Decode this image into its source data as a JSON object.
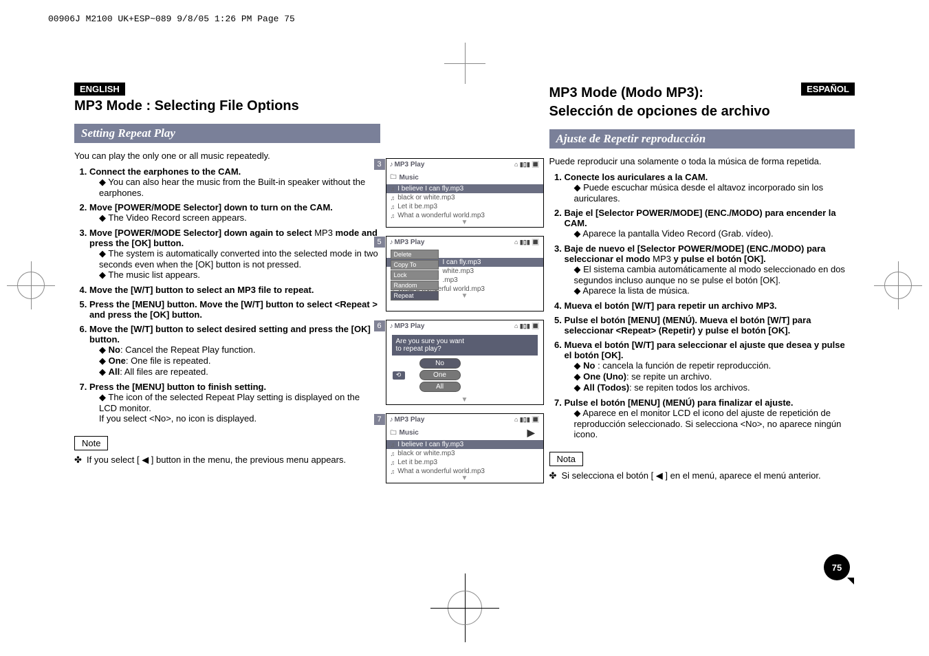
{
  "meta": {
    "running_head": "00906J M2100 UK+ESP~089  9/8/05 1:26 PM  Page 75"
  },
  "left": {
    "lang": "ENGLISH",
    "title": "MP3 Mode : Selecting File Options",
    "subhead": "Setting Repeat Play",
    "intro": "You can play the only one or all music repeatedly.",
    "step1": "Connect the earphones to the CAM.",
    "step1a": "You can also hear the music from the Built-in speaker without the earphones.",
    "step2": "Move [POWER/MODE Selector] down to turn on the CAM.",
    "step2a": "The Video Record screen appears.",
    "step3a": "Move [POWER/MODE Selector] down again to select ",
    "step3mode": "MP3",
    "step3b": " mode and press the [OK] button.",
    "step3s1": "The system is automatically converted into the selected mode in two seconds even when the [OK] button is not pressed.",
    "step3s2": "The music list appears.",
    "step4": "Move the [W/T] button to select an MP3 file to repeat.",
    "step5": "Press the [MENU] button. Move the [W/T] button to select <Repeat > and press the [OK] button.",
    "step6": "Move the [W/T] button to select desired setting and press the [OK] button.",
    "step6a_b": "No",
    "step6a_t": ": Cancel the Repeat Play function.",
    "step6b_b": "One",
    "step6b_t": ": One file is repeated.",
    "step6c_b": "All",
    "step6c_t": ": All files are repeated.",
    "step7": "Press the [MENU] button to finish setting.",
    "step7a": "The icon of the selected Repeat Play setting is displayed on the LCD monitor.",
    "step7b": "If you select <No>, no icon is displayed.",
    "note_label": "Note",
    "note": "If you select [ ◀ ] button in the menu, the previous menu appears."
  },
  "right": {
    "lang": "ESPAÑOL",
    "title1": "MP3 Mode (Modo MP3):",
    "title2": "Selección de opciones de archivo",
    "subhead": "Ajuste de Repetir reproducción",
    "intro": "Puede reproducir una solamente o toda la música de forma repetida.",
    "step1": "Conecte los auriculares a la CAM.",
    "step1a": "Puede escuchar música desde el altavoz incorporado sin los auriculares.",
    "step2": "Baje el [Selector POWER/MODE] (ENC./MODO) para encender la CAM.",
    "step2a": "Aparece la pantalla Video Record (Grab. vídeo).",
    "step3a": "Baje de nuevo el [Selector POWER/MODE] (ENC./MODO) para seleccionar el modo ",
    "step3mode": "MP3",
    "step3b": " y pulse el botón [OK].",
    "step3s1": "El sistema cambia automáticamente al modo seleccionado en dos segundos incluso aunque no se pulse el botón [OK].",
    "step3s2": "Aparece la lista de música.",
    "step4": "Mueva el botón [W/T] para repetir un archivo MP3.",
    "step5": "Pulse el botón [MENU] (MENÚ). Mueva el botón [W/T] para seleccionar <Repeat> (Repetir) y pulse el botón [OK].",
    "step6": "Mueva el botón [W/T] para seleccionar el ajuste que desea y pulse el botón [OK].",
    "step6a_b": "No",
    "step6a_t": " : cancela la función de repetir reproducción.",
    "step6b_b": "One (Uno)",
    "step6b_t": ": se repite un archivo.",
    "step6c_b": "All (Todos)",
    "step6c_t": ": se repiten todos los archivos.",
    "step7": "Pulse el botón [MENU] (MENÚ) para finalizar el ajuste.",
    "step7a": "Aparece en el monitor LCD el icono del ajuste de repetición de reproducción seleccionado. Si selecciona <No>, no aparece ningún icono.",
    "note_label": "Nota",
    "note": "Si selecciona el botón [ ◀ ] en el menú, aparece el menú anterior."
  },
  "screens": {
    "num3": "3",
    "num5": "5",
    "num6": "6",
    "num7": "7",
    "title": "MP3 Play",
    "status_icons": "⌂   ▮▯▮ 🔳",
    "music": "Music",
    "f1": "I believe I can fly.mp3",
    "f2": "black or white.mp3",
    "f3": "Let it be.mp3",
    "f4": "What a wonderful world.mp3",
    "m_delete": "Delete",
    "m_copyto": "Copy To",
    "m_lock": "Lock",
    "m_random": "Random",
    "m_repeat": "Repeat",
    "s5_1": "I can fly.mp3",
    "s5_2": "white.mp3",
    "s5_3": ".mp3",
    "prompt1": "Are you sure you want",
    "prompt2": "to repeat play?",
    "o_no": "No",
    "o_one": "One",
    "o_all": "All",
    "loop": "⟲"
  },
  "page_number": "75"
}
